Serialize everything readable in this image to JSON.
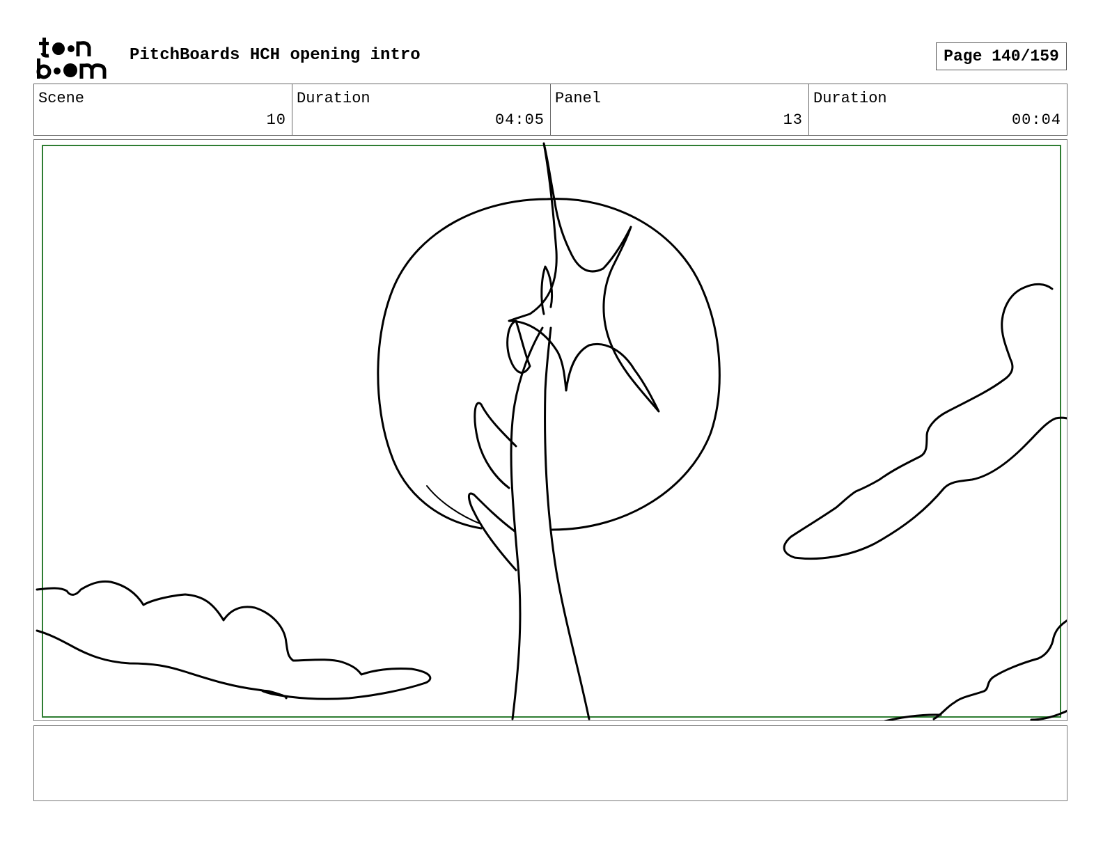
{
  "header": {
    "logo_text": "toon boom",
    "title": "PitchBoards HCH opening intro",
    "page_label": "Page 140/159"
  },
  "info": [
    {
      "label": "Scene",
      "value": "10"
    },
    {
      "label": "Duration",
      "value": "04:05"
    },
    {
      "label": "Panel",
      "value": "13"
    },
    {
      "label": "Duration",
      "value": "00:04"
    }
  ],
  "panel": {
    "safe_area_color": "#2e7d32",
    "stroke_color": "#000000"
  },
  "notes": {
    "text": ""
  }
}
